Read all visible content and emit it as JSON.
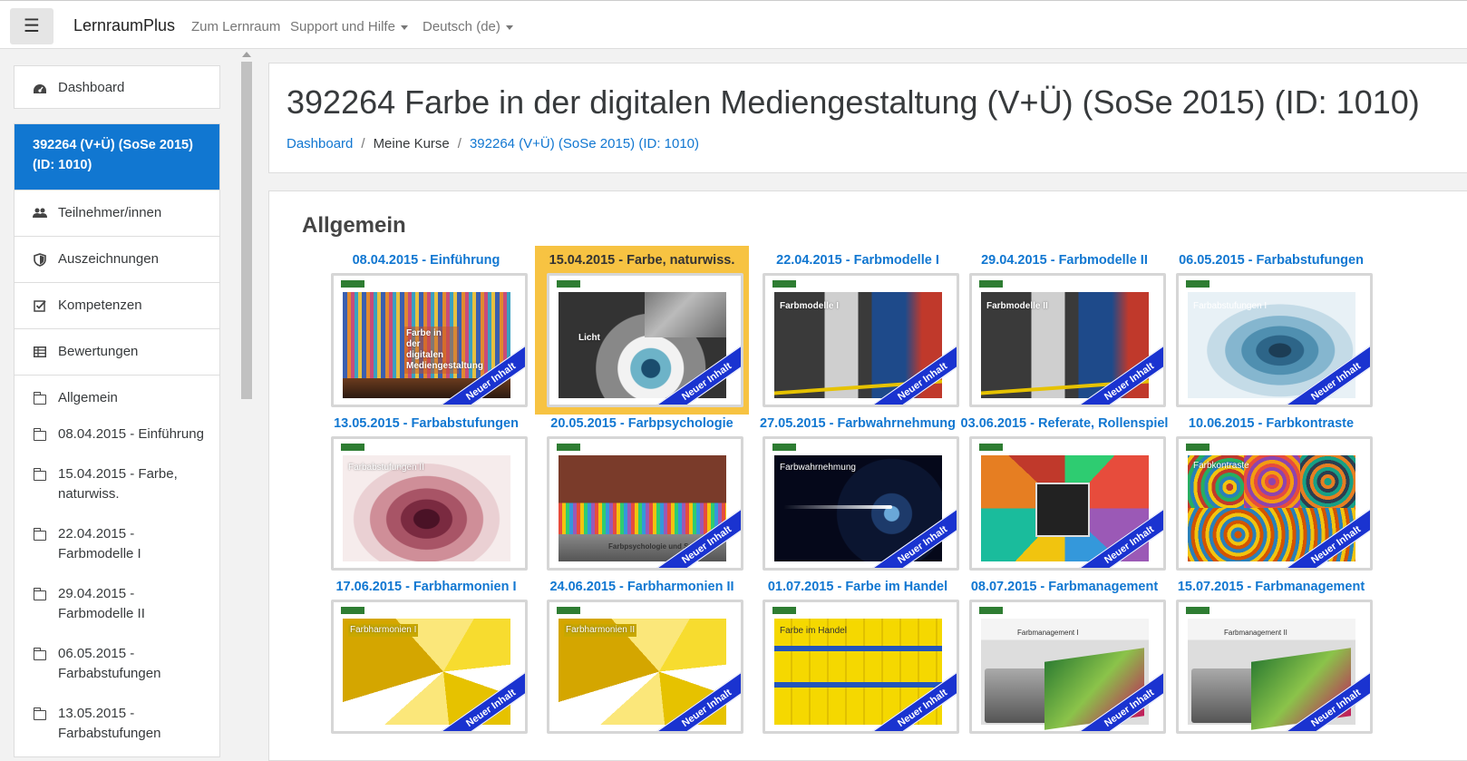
{
  "navbar": {
    "menu_icon": "hamburger-menu-icon",
    "brand": "LernraumPlus",
    "links": [
      "Zum Lernraum",
      "Support und Hilfe",
      "Deutsch (de)"
    ]
  },
  "sidebar": {
    "dashboard": "Dashboard",
    "active_course": "392264 (V+Ü) (SoSe 2015) (ID: 1010)",
    "items": [
      {
        "label": "Teilnehmer/innen",
        "icon": "users-icon"
      },
      {
        "label": "Auszeichnungen",
        "icon": "shield-icon"
      },
      {
        "label": "Kompetenzen",
        "icon": "checkbox-icon"
      },
      {
        "label": "Bewertungen",
        "icon": "table-icon"
      },
      {
        "label": "Allgemein",
        "icon": "folder-icon"
      },
      {
        "label": "08.04.2015 - Einführung",
        "icon": "folder-icon"
      },
      {
        "label": "15.04.2015 - Farbe, naturwiss.",
        "icon": "folder-icon"
      },
      {
        "label": "22.04.2015 - Farbmodelle I",
        "icon": "folder-icon"
      },
      {
        "label": "29.04.2015 - Farbmodelle II",
        "icon": "folder-icon"
      },
      {
        "label": "06.05.2015 - Farbabstufungen",
        "icon": "folder-icon"
      },
      {
        "label": "13.05.2015 - Farbabstufungen",
        "icon": "folder-icon"
      }
    ]
  },
  "header": {
    "title": "392264 Farbe in der digitalen Mediengestaltung (V+Ü) (SoSe 2015) (ID: 1010)",
    "breadcrumb": [
      "Dashboard",
      "Meine Kurse",
      "392264 (V+Ü) (SoSe 2015) (ID: 1010)"
    ]
  },
  "section": {
    "title": "Allgemein",
    "ribbon_label": "Neuer Inhalt",
    "tiles": [
      {
        "title": "08.04.2015 - Einführung",
        "slide_text": "Farbe in der digitalen Mediengestaltung",
        "image": "theater-curtain"
      },
      {
        "title": "15.04.2015 - Farbe, naturwiss.",
        "slide_text": "Licht",
        "image": "eye-closeup",
        "highlighted": true
      },
      {
        "title": "22.04.2015 - Farbmodelle I",
        "slide_text": "Farbmodelle I",
        "image": "gallery-wall"
      },
      {
        "title": "29.04.2015 - Farbmodelle II",
        "slide_text": "Farbmodelle II",
        "image": "gallery-wall"
      },
      {
        "title": "06.05.2015 - Farbabstufungen",
        "slide_text": "Farbabstufungen I",
        "image": "blue-gradient"
      },
      {
        "title": "13.05.2015 - Farbabstufungen",
        "slide_text": "Farbabstufungen II",
        "image": "red-gradient"
      },
      {
        "title": "20.05.2015 - Farbpsychologie",
        "slide_text": "Farbpsychologie und Symbolik",
        "image": "brick-building"
      },
      {
        "title": "27.05.2015 - Farbwahrnehmung",
        "slide_text": "Farbwahrnehmung",
        "image": "eye-light"
      },
      {
        "title": "03.06.2015 - Referate, Rollenspiel",
        "slide_text": "",
        "image": "colorful-bathrooms"
      },
      {
        "title": "10.06.2015 - Farbkontraste",
        "slide_text": "Farbkontraste",
        "image": "concentric-circles"
      },
      {
        "title": "17.06.2015 - Farbharmonien I",
        "slide_text": "Farbharmonien I",
        "image": "yellow-collage"
      },
      {
        "title": "24.06.2015 - Farbharmonien II",
        "slide_text": "Farbharmonien II",
        "image": "yellow-collage"
      },
      {
        "title": "01.07.2015 - Farbe im Handel",
        "slide_text": "Farbe im Handel",
        "image": "langenscheidt-books"
      },
      {
        "title": "08.07.2015 - Farbmanagement",
        "slide_text": "Farbmanagement I",
        "image": "printer-hummingbird"
      },
      {
        "title": "15.07.2015 - Farbmanagement",
        "slide_text": "Farbmanagement II",
        "image": "printer-hummingbird"
      }
    ]
  }
}
